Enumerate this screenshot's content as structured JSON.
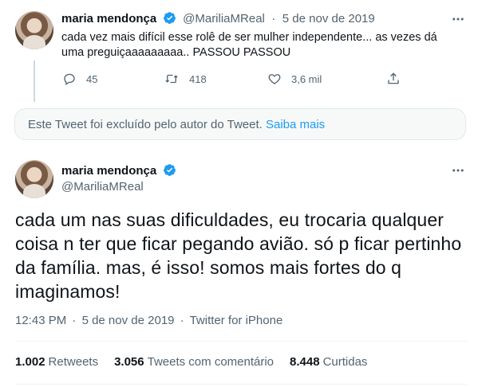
{
  "tweet1": {
    "name": "maria mendonça",
    "handle": "@MariliaMReal",
    "date": "5 de nov de 2019",
    "line1": "cada vez mais difícil esse rolê de ser mulher independente... as vezes dá",
    "line2": "uma preguiçaaaaaaaaa.. PASSOU PASSOU",
    "replies": "45",
    "retweets": "418",
    "likes": "3,6 mil"
  },
  "deleted_notice": {
    "text": "Este Tweet foi excluído pelo autor do Tweet.",
    "link": "Saiba mais"
  },
  "tweet2": {
    "name": "maria mendonça",
    "handle": "@MariliaMReal",
    "line1": "cada um nas suas dificuldades, eu trocaria qualquer",
    "line2": "coisa n ter que ficar pegando avião. só p ficar pertinho",
    "line3": "da família. mas, é isso! somos mais fortes do q",
    "line4": "imaginamos!",
    "time": "12:43 PM",
    "date": "5 de nov de 2019",
    "source": "Twitter for iPhone",
    "retweets_count": "1.002",
    "retweets_label": "Retweets",
    "quotes_count": "3.056",
    "quotes_label": "Tweets com comentário",
    "likes_count": "8.448",
    "likes_label": "Curtidas"
  },
  "colors": {
    "accent": "#1d9bf0",
    "muted": "#536471",
    "text": "#0f1419"
  }
}
